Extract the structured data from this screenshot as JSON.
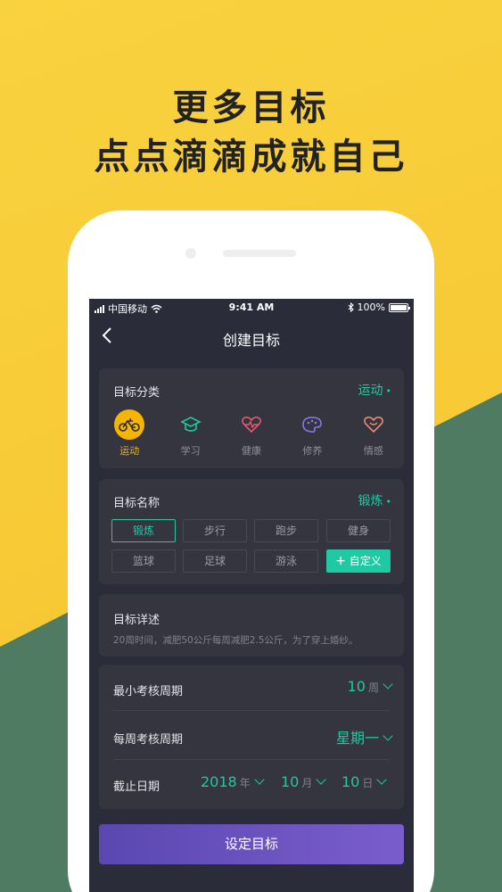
{
  "headline": {
    "line1": "更多目标",
    "line2": "点点滴滴成就自己"
  },
  "statusbar": {
    "carrier": "中国移动",
    "time": "9:41 AM",
    "battery": "100%"
  },
  "nav": {
    "title": "创建目标"
  },
  "category": {
    "label": "目标分类",
    "selected": "运动",
    "items": [
      {
        "label": "运动",
        "icon": "bicycle-icon",
        "color": "#2B2C39"
      },
      {
        "label": "学习",
        "icon": "graduation-cap-icon",
        "color": "#1EC9A4"
      },
      {
        "label": "健康",
        "icon": "heartbeat-icon",
        "color": "#E65A6B"
      },
      {
        "label": "修养",
        "icon": "palette-icon",
        "color": "#8A78E8"
      },
      {
        "label": "情感",
        "icon": "heart-icon",
        "color": "#EE8A6F"
      }
    ]
  },
  "name": {
    "label": "目标名称",
    "selected": "锻炼",
    "chips": [
      "锻炼",
      "步行",
      "跑步",
      "健身",
      "篮球",
      "足球",
      "游泳"
    ],
    "custom": "自定义"
  },
  "detail": {
    "label": "目标详述",
    "text": "20周时间，减肥50公斤每周减肥2.5公斤，为了穿上婚纱。"
  },
  "settings": {
    "min_period_label": "最小考核周期",
    "min_period_value": "10",
    "min_period_unit": "周",
    "weekly_label": "每周考核周期",
    "weekly_value": "星期一",
    "deadline_label": "截止日期",
    "year": "2018",
    "year_unit": "年",
    "month": "10",
    "month_unit": "月",
    "day": "10",
    "day_unit": "日"
  },
  "submit": {
    "label": "设定目标"
  },
  "colors": {
    "accent": "#1EC9A4",
    "active": "#F5B500",
    "button": "#6B55C4",
    "screen": "#2B2C39"
  }
}
